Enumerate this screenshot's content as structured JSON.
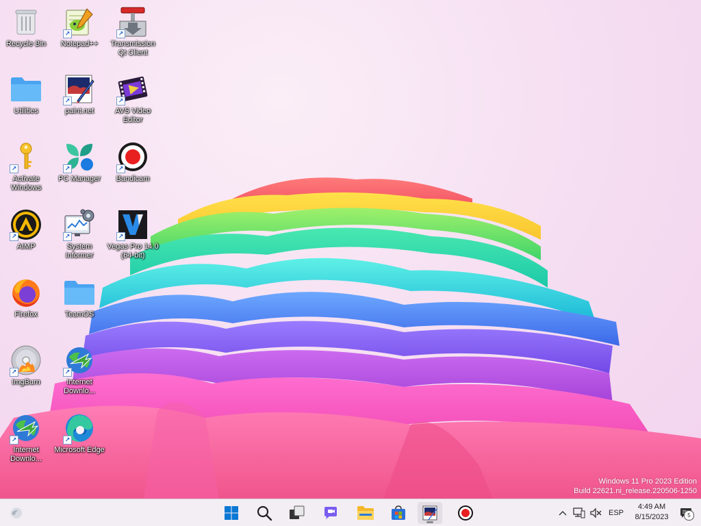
{
  "desktop_icons": [
    {
      "name": "recycle-bin-icon",
      "label": "Recycle Bin"
    },
    {
      "name": "notepad-plus-plus-icon",
      "label": "Notepad++"
    },
    {
      "name": "transmission-icon",
      "label": "Transmission Qt Client"
    },
    {
      "name": "folder-icon",
      "label": "Utilities"
    },
    {
      "name": "paintnet-icon",
      "label": "paint.net"
    },
    {
      "name": "film-icon",
      "label": "AVS Video Editor"
    },
    {
      "name": "key-icon",
      "label": "Activate Windows"
    },
    {
      "name": "pc-manager-icon",
      "label": "PC Manager"
    },
    {
      "name": "record-icon",
      "label": "Bandicam"
    },
    {
      "name": "aimp-icon",
      "label": "AIMP"
    },
    {
      "name": "system-informer-icon",
      "label": "System Informer"
    },
    {
      "name": "vegas-icon",
      "label": "Vegas Pro 14.0 (64-bit)"
    },
    {
      "name": "firefox-icon",
      "label": "Firefox"
    },
    {
      "name": "folder-icon",
      "label": "TeamOS"
    },
    {
      "name": "disc-icon",
      "label": "ImgBurn"
    },
    {
      "name": "download-manager-icon",
      "label": "Internet Downlo..."
    },
    {
      "name": "download-manager-icon",
      "label": "Internet Downlo..."
    },
    {
      "name": "edge-icon",
      "label": "Microsoft Edge"
    }
  ],
  "watermark": {
    "line1": "Windows 11 Pro 2023 Edition",
    "line2": "Build 22621.ni_release.220506-1250"
  },
  "taskbar": {
    "apps": [
      {
        "name": "start-button",
        "icon": "windows-logo-icon",
        "active": false
      },
      {
        "name": "search-button",
        "icon": "search-icon",
        "active": false
      },
      {
        "name": "task-view-button",
        "icon": "task-view-icon",
        "active": false
      },
      {
        "name": "chat-button",
        "icon": "chat-icon",
        "active": false
      },
      {
        "name": "file-explorer-button",
        "icon": "folder-icon",
        "active": false
      },
      {
        "name": "store-button",
        "icon": "store-icon",
        "active": false
      },
      {
        "name": "paintnet-taskbar-button",
        "icon": "paintnet-icon",
        "active": true
      },
      {
        "name": "bandicam-taskbar-button",
        "icon": "record-icon",
        "active": false
      }
    ],
    "tray": {
      "language": "ESP",
      "time": "4:49 AM",
      "date": "8/15/2023",
      "notification_count": "5"
    }
  },
  "colors": {
    "taskbar_bg": "#f2eef3",
    "accent_blue": "#0a78d4"
  }
}
